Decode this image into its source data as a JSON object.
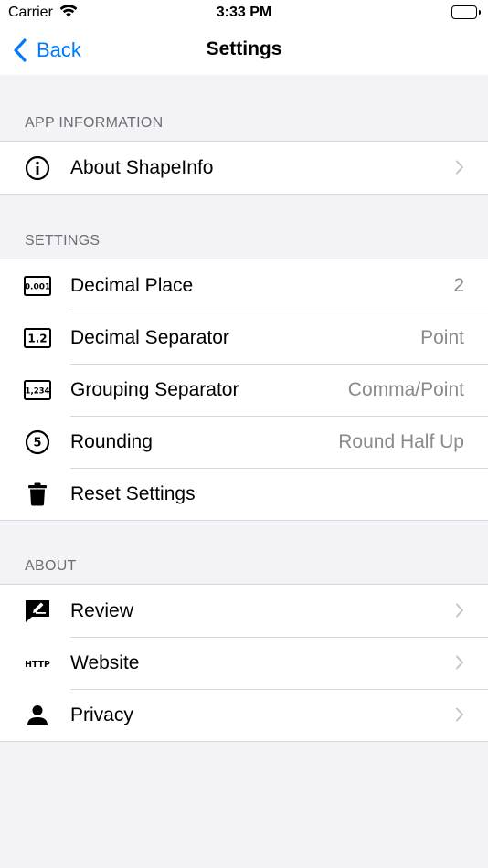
{
  "status": {
    "carrier": "Carrier",
    "time": "3:33 PM"
  },
  "nav": {
    "back_label": "Back",
    "title": "Settings"
  },
  "sections": {
    "app_info": {
      "header": "APP INFORMATION",
      "items": [
        {
          "label": "About ShapeInfo",
          "icon": "info-circle-icon"
        }
      ]
    },
    "settings": {
      "header": "SETTINGS",
      "items": [
        {
          "label": "Decimal Place",
          "value": "2",
          "icon": "decimal-place-icon"
        },
        {
          "label": "Decimal Separator",
          "value": "Point",
          "icon": "decimal-separator-icon"
        },
        {
          "label": "Grouping Separator",
          "value": "Comma/Point",
          "icon": "grouping-separator-icon"
        },
        {
          "label": "Rounding",
          "value": "Round Half Up",
          "icon": "rounding-icon"
        },
        {
          "label": "Reset Settings",
          "icon": "trash-icon"
        }
      ]
    },
    "about": {
      "header": "ABOUT",
      "items": [
        {
          "label": "Review",
          "icon": "review-icon"
        },
        {
          "label": "Website",
          "icon": "http-icon"
        },
        {
          "label": "Privacy",
          "icon": "person-icon"
        }
      ]
    }
  },
  "icon_text": {
    "decimal_place": "0.001",
    "decimal_separator": "1.2",
    "grouping_separator": "1,234",
    "rounding": "5",
    "http": "HTTP"
  },
  "colors": {
    "accent": "#007aff",
    "background": "#f2f2f7",
    "secondary_text": "#8a8a8e"
  }
}
